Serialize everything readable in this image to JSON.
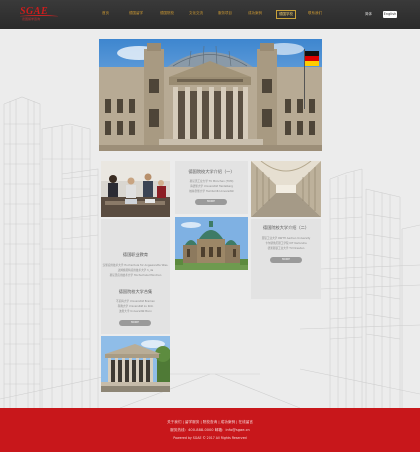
{
  "header": {
    "logo_text": "SGAE",
    "logo_sub": "德国留学咨询",
    "nav": [
      "首页",
      "德国留学",
      "德国院校",
      "文化交流",
      "服务项目",
      "成功案例",
      "德国学校",
      "联系我们"
    ],
    "active_index": 6,
    "lang_cn": "简体",
    "lang_en": "English"
  },
  "cards": {
    "card1": {
      "title": "德国院校大学介绍（一）",
      "lines": [
        "慕尼黑工业大学 TU München (TUM)",
        "海德堡大学 Universität Heidelberg",
        "柏林洪堡大学 Humboldt-Universität"
      ],
      "button": "MORE"
    },
    "card2": {
      "title": "德国职业教育",
      "lines": [
        "汉堡应用技术大学 Hochschule für Angewandte Wiss.",
        "达姆施塔特应用技术大学 h_da",
        "慕尼黑应用技术大学 Hochschule München"
      ],
      "button": "MORE"
    },
    "card3": {
      "title": "德国院校大学介绍（二）",
      "lines": [
        "亚琛工业大学 RWTH Aachen University",
        "卡尔斯鲁厄理工学院 KIT Karlsruhe",
        "德累斯顿工业大学 TU Dresden"
      ],
      "button": "MORE"
    },
    "card4": {
      "title": "德国院校大学合集",
      "lines": [
        "不莱梅大学 Universität Bremen",
        "科隆大学 Universität zu Köln",
        "波恩大学 Universität Bonn"
      ],
      "button": "MORE"
    }
  },
  "footer": {
    "links": "关于我们  |  留学服务  |  院校查询  |  成功案例  |  在线留言",
    "contact": "服务热线：400-888-0000    邮箱：info@sgae.cn",
    "copyright": "Powered by SGAE © 2017 All Rights Reserved"
  },
  "colors": {
    "footer_red": "#c8171b",
    "topbar": "#2f2f2f",
    "nav_gold": "#cc9933",
    "card_bg": "#e3e3e3",
    "button_gray": "#9a9a9a"
  }
}
